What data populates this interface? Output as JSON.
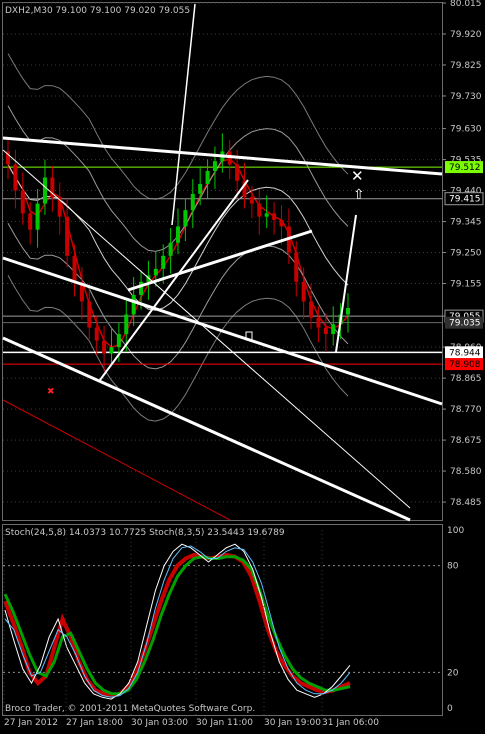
{
  "symbol_label": "DXH2,M30  79.100 79.100 79.020 79.055",
  "indicator_label": "Stoch(24,5,8) 14.0373 10.7725  Stoch(8,3,5) 23.5443 19.6789",
  "copyright": "Broco Trader, © 2001-2011 MetaQuotes Software Corp.",
  "colors": {
    "background": "#000000",
    "grid": "#3a3a3a",
    "text": "#c8c8c8",
    "bull": "#00c800",
    "bear": "#c80000",
    "trendline": "#ffffff",
    "green_level": "#7cfc00",
    "red_level": "#ff0000"
  },
  "chart_data": [
    {
      "type": "candlestick",
      "title": "DXH2,M30",
      "ylim": [
        78.43,
        80.015
      ],
      "yticks": [
        80.015,
        79.92,
        79.825,
        79.73,
        79.63,
        79.535,
        79.44,
        79.345,
        79.25,
        79.155,
        79.055,
        78.96,
        78.865,
        78.77,
        78.675,
        78.58,
        78.485
      ],
      "xticks": [
        "27 Jan 2012",
        "27 Jan 18:00",
        "30 Jan 03:00",
        "30 Jan 11:00",
        "30 Jan 19:00",
        "31 Jan 06:00"
      ],
      "price_tags": [
        {
          "value": "79.512",
          "style": "green"
        },
        {
          "value": "79.415",
          "style": "gray"
        },
        {
          "value": "79.055",
          "style": "gray"
        },
        {
          "value": "79.035",
          "style": "dark"
        },
        {
          "value": "78.944",
          "style": "white"
        },
        {
          "value": "78.908",
          "style": "red"
        }
      ],
      "closes": [
        79.52,
        79.44,
        79.37,
        79.32,
        79.4,
        79.48,
        79.42,
        79.36,
        79.24,
        79.16,
        79.1,
        79.02,
        78.98,
        78.94,
        78.96,
        79.0,
        79.06,
        79.12,
        79.16,
        79.18,
        79.2,
        79.24,
        79.28,
        79.33,
        79.38,
        79.43,
        79.46,
        79.5,
        79.53,
        79.56,
        79.52,
        79.47,
        79.42,
        79.4,
        79.36,
        79.37,
        79.35,
        79.33,
        79.25,
        79.16,
        79.1,
        79.05,
        79.02,
        79.0,
        79.03,
        79.06,
        79.08
      ]
    },
    {
      "type": "line",
      "title": "Stoch(24,5,8) / Stoch(8,3,5)",
      "ylim": [
        0,
        100
      ],
      "yticks": [
        100,
        80,
        20,
        0
      ],
      "series": [
        {
          "name": "Stoch(24,5,8) main",
          "values": [
            60,
            48,
            35,
            20,
            14,
            18,
            34,
            50,
            40,
            26,
            16,
            10,
            8,
            7,
            8,
            12,
            20,
            32,
            46,
            60,
            72,
            80,
            84,
            86,
            85,
            84,
            85,
            86,
            85,
            82,
            74,
            60,
            44,
            32,
            24,
            18,
            14,
            12,
            10,
            9,
            10,
            12,
            14
          ]
        },
        {
          "name": "Stoch(24,5,8) signal",
          "values": [
            64,
            54,
            42,
            30,
            20,
            18,
            26,
            40,
            42,
            32,
            22,
            14,
            10,
            8,
            8,
            10,
            16,
            26,
            38,
            52,
            64,
            74,
            80,
            84,
            85,
            84,
            84,
            85,
            85,
            83,
            78,
            66,
            52,
            40,
            30,
            22,
            17,
            14,
            12,
            10,
            10,
            11,
            12
          ]
        },
        {
          "name": "Stoch(8,3,5) main",
          "values": [
            55,
            38,
            22,
            14,
            24,
            40,
            50,
            34,
            24,
            14,
            8,
            6,
            5,
            8,
            14,
            26,
            46,
            66,
            80,
            88,
            92,
            90,
            86,
            82,
            86,
            90,
            92,
            88,
            78,
            62,
            42,
            26,
            16,
            10,
            8,
            6,
            8,
            12,
            18,
            24
          ]
        },
        {
          "name": "Stoch(8,3,5) signal",
          "values": [
            50,
            44,
            30,
            18,
            20,
            32,
            44,
            40,
            30,
            18,
            10,
            7,
            6,
            7,
            11,
            20,
            36,
            56,
            72,
            84,
            90,
            91,
            88,
            84,
            84,
            88,
            90,
            89,
            82,
            70,
            52,
            34,
            22,
            14,
            10,
            8,
            8,
            10,
            14,
            20
          ]
        }
      ]
    }
  ]
}
